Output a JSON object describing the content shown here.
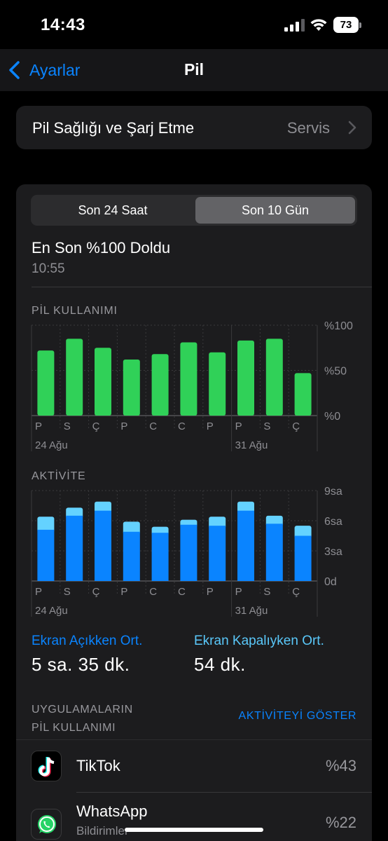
{
  "status": {
    "time": "14:43",
    "battery": "73"
  },
  "nav": {
    "back_label": "Ayarlar",
    "title": "Pil"
  },
  "health": {
    "label": "Pil Sağlığı ve Şarj Etme",
    "value": "Servis"
  },
  "segments": [
    "Son 24 Saat",
    "Son 10 Gün"
  ],
  "last_charged": {
    "title": "En Son %100 Doldu",
    "time": "10:55"
  },
  "battery_chart": {
    "label": "PİL KULLANIMI",
    "y_ticks": [
      "%100",
      "%50",
      "%0"
    ],
    "day_labels": [
      "P",
      "S",
      "Ç",
      "P",
      "C",
      "C",
      "P",
      "P",
      "S",
      "Ç"
    ],
    "date_labels": [
      "24 Ağu",
      "31 Ağu"
    ]
  },
  "activity_chart": {
    "label": "AKTİVİTE",
    "y_ticks": [
      "9sa",
      "6sa",
      "3sa",
      "0d"
    ],
    "day_labels": [
      "P",
      "S",
      "Ç",
      "P",
      "C",
      "C",
      "P",
      "P",
      "S",
      "Ç"
    ],
    "date_labels": [
      "24 Ağu",
      "31 Ağu"
    ]
  },
  "chart_data": [
    {
      "type": "bar",
      "title": "PİL KULLANIMI",
      "categories": [
        "P",
        "S",
        "Ç",
        "P",
        "C",
        "C",
        "P",
        "P",
        "S",
        "Ç"
      ],
      "values": [
        72,
        85,
        75,
        62,
        68,
        81,
        70,
        83,
        85,
        47
      ],
      "ylim": [
        0,
        100
      ],
      "color": "#30d158"
    },
    {
      "type": "bar",
      "title": "AKTİVİTE",
      "categories": [
        "P",
        "S",
        "Ç",
        "P",
        "C",
        "C",
        "P",
        "P",
        "S",
        "Ç"
      ],
      "series": [
        {
          "name": "Ekran Açıkken Ort.",
          "values": [
            5.1,
            6.5,
            7.0,
            4.9,
            4.8,
            5.6,
            5.5,
            7.0,
            5.7,
            4.5
          ]
        },
        {
          "name": "Ekran Kapalıyken Ort.",
          "values": [
            1.3,
            0.8,
            0.9,
            1.0,
            0.6,
            0.5,
            0.9,
            0.9,
            0.8,
            1.0
          ]
        }
      ],
      "ylim": [
        0,
        9
      ],
      "colors": [
        "#0a84ff",
        "#64d2ff"
      ]
    }
  ],
  "stats": {
    "screen_on_label": "Ekran Açıkken Ort.",
    "screen_on_value": "5 sa. 35 dk.",
    "screen_off_label": "Ekran Kapalıyken Ort.",
    "screen_off_value": "54 dk."
  },
  "apps": {
    "header_line1": "UYGULAMALARIN",
    "header_line2": "PİL KULLANIMI",
    "activity_link": "AKTİVİTEYİ GÖSTER",
    "items": [
      {
        "name": "TikTok",
        "sub": "",
        "pct": "%43"
      },
      {
        "name": "WhatsApp",
        "sub": "Bildirimler",
        "pct": "%22"
      }
    ]
  }
}
